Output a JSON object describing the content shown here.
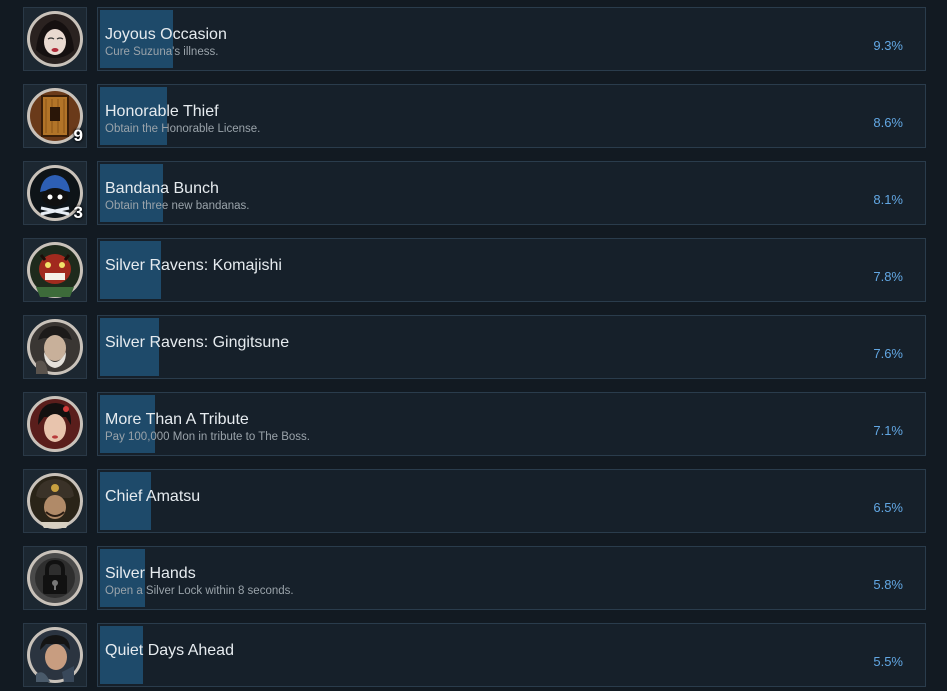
{
  "colors": {
    "background": "#121a22",
    "row_background": "#16202a",
    "progress_fill": "#1e4a6a",
    "percent_text": "#62a7e3"
  },
  "achievements": [
    {
      "title": "Joyous Occasion",
      "description": "Cure Suzuna's illness.",
      "percent": "9.3%",
      "progress": 9.3,
      "icon": "geisha-portrait-icon",
      "badge": ""
    },
    {
      "title": "Honorable Thief",
      "description": "Obtain the Honorable License.",
      "percent": "8.6%",
      "progress": 8.6,
      "icon": "wooden-license-icon",
      "badge": "9"
    },
    {
      "title": "Bandana Bunch",
      "description": "Obtain three new bandanas.",
      "percent": "8.1%",
      "progress": 8.1,
      "icon": "blue-bandana-icon",
      "badge": "3"
    },
    {
      "title": "Silver Ravens: Komajishi",
      "description": "",
      "percent": "7.8%",
      "progress": 7.8,
      "icon": "lion-mask-icon",
      "badge": ""
    },
    {
      "title": "Silver Ravens: Gingitsune",
      "description": "",
      "percent": "7.6%",
      "progress": 7.6,
      "icon": "masked-warrior-icon",
      "badge": ""
    },
    {
      "title": "More Than A Tribute",
      "description": "Pay 100,000 Mon in tribute to The Boss.",
      "percent": "7.1%",
      "progress": 7.1,
      "icon": "woman-portrait-icon",
      "badge": ""
    },
    {
      "title": "Chief Amatsu",
      "description": "",
      "percent": "6.5%",
      "progress": 6.5,
      "icon": "samurai-helmet-icon",
      "badge": ""
    },
    {
      "title": "Silver Hands",
      "description": "Open a Silver Lock within 8 seconds.",
      "percent": "5.8%",
      "progress": 5.8,
      "icon": "padlock-icon",
      "badge": ""
    },
    {
      "title": "Quiet Days Ahead",
      "description": "",
      "percent": "5.5%",
      "progress": 5.5,
      "icon": "man-portrait-icon",
      "badge": ""
    }
  ]
}
